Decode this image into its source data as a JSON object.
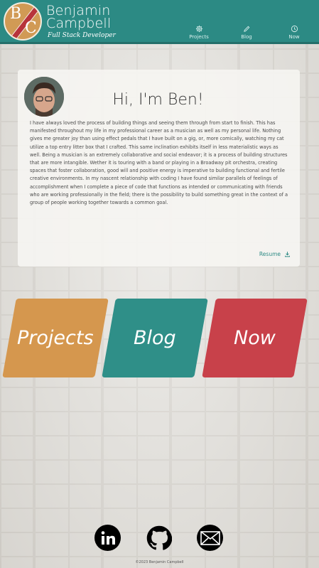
{
  "brand": {
    "logo_letters": [
      "B",
      "C"
    ],
    "name_line1": "Benjamin",
    "name_line2": "Campbell",
    "subtitle": "Full Stack Developer"
  },
  "nav": [
    {
      "label": "Projects",
      "icon": "gear-icon"
    },
    {
      "label": "Blog",
      "icon": "pencil-icon"
    },
    {
      "label": "Now",
      "icon": "clock-icon"
    }
  ],
  "bio": {
    "title": "Hi, I'm Ben!",
    "body": "I have always loved the process of building things and seeing them through from start to finish. This has manifested throughout my life in my professional career as a musician as well as my personal life. Nothing gives me greater joy than using effect pedals that I have built on a gig, or, more comically, watching my cat utilize a top entry litter box that I crafted. This same inclination exhibits itself in less materialistic ways as well. Being a musician is an extremely collaborative and social endeavor; it is a process of building structures that are more intangible. Wether it is touring with a band or playing in a Broadway pit orchestra, creating spaces that foster collaboration, good will and positive energy is imperative to building functional and fertile creative environments. In my nascent relationship with coding I have found similar parallels of feelings of accomplishment when I complete a piece of code that functions as intended or communicating with friends who are working professionally in the field; there is the possibility to build something great in the context of a group of people working together towards a common goal.",
    "resume_label": "Resume"
  },
  "big_links": {
    "projects": "Projects",
    "blog": "Blog",
    "now": "Now"
  },
  "social": [
    "linkedin-icon",
    "github-icon",
    "mail-icon"
  ],
  "footer": {
    "copyright": "©2023 Benjamin Campbell"
  },
  "colors": {
    "header": "#2c8a84",
    "projects": "#d5974e",
    "blog": "#2f8f88",
    "now": "#c8414a"
  }
}
